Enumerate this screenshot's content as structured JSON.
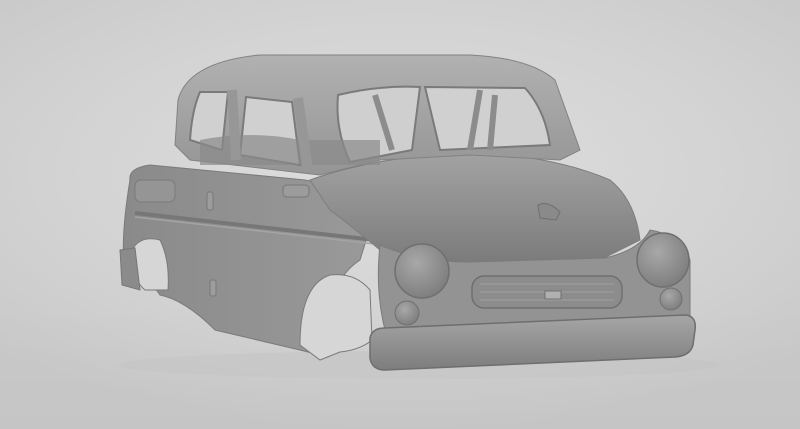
{
  "scene": {
    "subject": "car-body-3d-model",
    "background_color": "#d6d6d6",
    "model_color": "#8e8e8e"
  }
}
